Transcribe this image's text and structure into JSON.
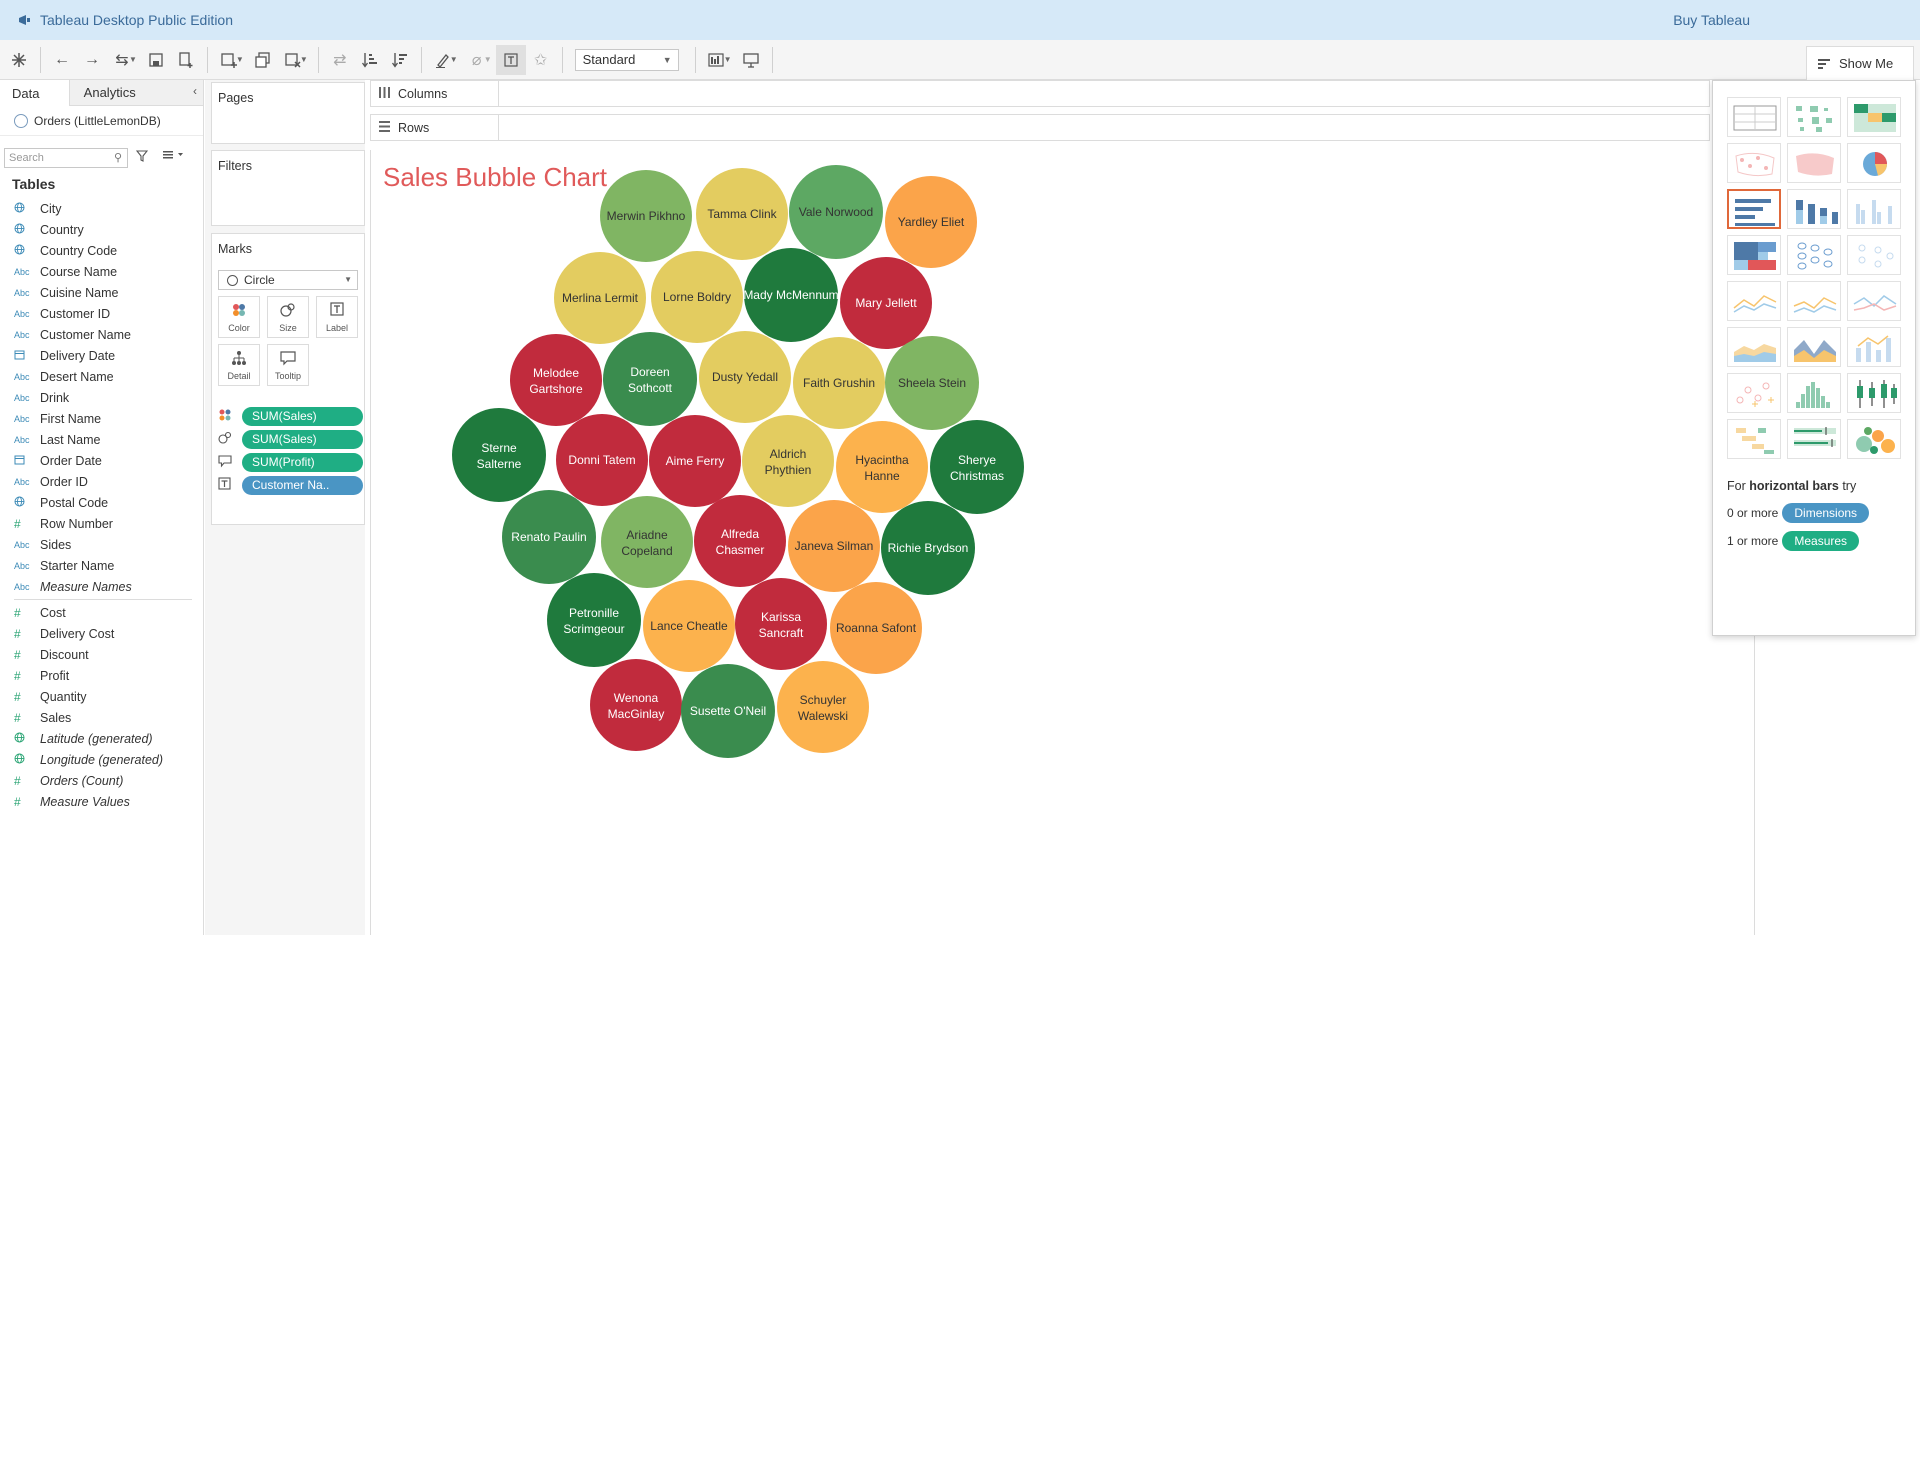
{
  "window": {
    "app_title": "Tableau Desktop Public Edition",
    "buy_label": "Buy Tableau"
  },
  "toolbar": {
    "fit_value": "Standard",
    "show_me_label": "Show Me"
  },
  "data_pane": {
    "tabs": [
      "Data",
      "Analytics"
    ],
    "datasource": "Orders (LittleLemonDB)",
    "search_placeholder": "Search",
    "tables_heading": "Tables",
    "dimensions": [
      {
        "name": "City",
        "type": "geo"
      },
      {
        "name": "Country",
        "type": "geo"
      },
      {
        "name": "Country Code",
        "type": "geo"
      },
      {
        "name": "Course Name",
        "type": "string"
      },
      {
        "name": "Cuisine Name",
        "type": "string"
      },
      {
        "name": "Customer ID",
        "type": "string"
      },
      {
        "name": "Customer Name",
        "type": "string"
      },
      {
        "name": "Delivery Date",
        "type": "date"
      },
      {
        "name": "Desert Name",
        "type": "string"
      },
      {
        "name": "Drink",
        "type": "string"
      },
      {
        "name": "First Name",
        "type": "string"
      },
      {
        "name": "Last Name",
        "type": "string"
      },
      {
        "name": "Order Date",
        "type": "date"
      },
      {
        "name": "Order ID",
        "type": "string"
      },
      {
        "name": "Postal Code",
        "type": "geo"
      },
      {
        "name": "Row Number",
        "type": "number"
      },
      {
        "name": "Sides",
        "type": "string"
      },
      {
        "name": "Starter Name",
        "type": "string"
      },
      {
        "name": "Measure Names",
        "type": "string",
        "italic": true
      }
    ],
    "measures": [
      {
        "name": "Cost",
        "type": "number"
      },
      {
        "name": "Delivery Cost",
        "type": "number"
      },
      {
        "name": "Discount",
        "type": "number"
      },
      {
        "name": "Profit",
        "type": "number"
      },
      {
        "name": "Quantity",
        "type": "number"
      },
      {
        "name": "Sales",
        "type": "number"
      },
      {
        "name": "Latitude (generated)",
        "type": "geo",
        "italic": true
      },
      {
        "name": "Longitude (generated)",
        "type": "geo",
        "italic": true
      },
      {
        "name": "Orders (Count)",
        "type": "number",
        "italic": true
      },
      {
        "name": "Measure Values",
        "type": "number",
        "italic": true
      }
    ]
  },
  "icons": {
    "string_type": "Abc",
    "number_type": "#",
    "geo_type": "globe-icon",
    "date_type": "calendar-icon"
  },
  "shelves": {
    "pages": "Pages",
    "filters": "Filters",
    "marks": "Marks",
    "columns": "Columns",
    "rows": "Rows"
  },
  "marks_card": {
    "mark_type": "Circle",
    "buttons": [
      "Color",
      "Size",
      "Label",
      "Detail",
      "Tooltip"
    ],
    "pills": [
      {
        "label": "SUM(Sales)",
        "kind": "measure",
        "encoding": "color"
      },
      {
        "label": "SUM(Sales)",
        "kind": "measure",
        "encoding": "size"
      },
      {
        "label": "SUM(Profit)",
        "kind": "measure",
        "encoding": "tooltip"
      },
      {
        "label": "Customer Na..",
        "kind": "dimension",
        "encoding": "label"
      }
    ]
  },
  "show_me": {
    "hint_prefix": "For",
    "hint_chart": "horizontal bars",
    "hint_suffix": "try",
    "dimensions_prefix": "0 or more",
    "dimensions_badge": "Dimensions",
    "measures_prefix": "1 or more",
    "measures_badge": "Measures",
    "selected_index": 6
  },
  "colors": {
    "dark_green": "#1f7a3d",
    "green": "#3a8c4e",
    "mid_green": "#5da863",
    "light_green": "#80b563",
    "yellow": "#e3cc60",
    "light_orange": "#fcb24d",
    "orange": "#fba44a",
    "red": "#c12b3d",
    "title": "#e05a5a"
  },
  "chart_data": {
    "type": "bubble",
    "title": "Sales Bubble Chart",
    "encoding": {
      "color": "SUM(Sales)",
      "size": "SUM(Sales)",
      "label": "Customer Name"
    },
    "bubbles": [
      {
        "name": "Merwin Pikhno",
        "color": "light_green"
      },
      {
        "name": "Tamma Clink",
        "color": "yellow"
      },
      {
        "name": "Vale Norwood",
        "color": "mid_green"
      },
      {
        "name": "Yardley Eliet",
        "color": "orange"
      },
      {
        "name": "Merlina Lermit",
        "color": "yellow"
      },
      {
        "name": "Lorne Boldry",
        "color": "yellow"
      },
      {
        "name": "Mady McMennum",
        "color": "dark_green"
      },
      {
        "name": "Mary Jellett",
        "color": "red"
      },
      {
        "name": "Melodee Gartshore",
        "color": "red"
      },
      {
        "name": "Doreen Sothcott",
        "color": "green"
      },
      {
        "name": "Dusty Yedall",
        "color": "yellow"
      },
      {
        "name": "Faith Grushin",
        "color": "yellow"
      },
      {
        "name": "Sheela Stein",
        "color": "light_green"
      },
      {
        "name": "Sterne Salterne",
        "color": "dark_green"
      },
      {
        "name": "Donni Tatem",
        "color": "red"
      },
      {
        "name": "Aime Ferry",
        "color": "red"
      },
      {
        "name": "Aldrich Phythien",
        "color": "yellow"
      },
      {
        "name": "Hyacintha Hanne",
        "color": "light_orange"
      },
      {
        "name": "Sherye Christmas",
        "color": "dark_green"
      },
      {
        "name": "Renato Paulin",
        "color": "green"
      },
      {
        "name": "Ariadne Copeland",
        "color": "light_green"
      },
      {
        "name": "Alfreda Chasmer",
        "color": "red"
      },
      {
        "name": "Janeva Silman",
        "color": "orange"
      },
      {
        "name": "Richie Brydson",
        "color": "dark_green"
      },
      {
        "name": "Petronille Scrimgeour",
        "color": "dark_green"
      },
      {
        "name": "Lance Cheatle",
        "color": "light_orange"
      },
      {
        "name": "Karissa Sancraft",
        "color": "red"
      },
      {
        "name": "Roanna Safont",
        "color": "orange"
      },
      {
        "name": "Wenona MacGinlay",
        "color": "red"
      },
      {
        "name": "Susette O'Neil",
        "color": "green"
      },
      {
        "name": "Schuyler Walewski",
        "color": "light_orange"
      }
    ]
  }
}
